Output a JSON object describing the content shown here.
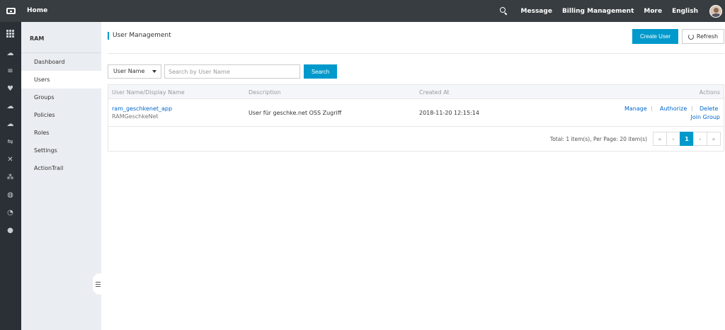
{
  "topbar": {
    "home": "Home",
    "links": [
      "Message",
      "Billing Management",
      "More",
      "English"
    ]
  },
  "rail": {
    "icons": [
      "apps-grid-icon",
      "cloud-icon",
      "database-icon",
      "trophy-icon",
      "cloud-upload-icon",
      "cloud-icon",
      "transfer-icon",
      "close-x-icon",
      "network-icon",
      "globe-icon",
      "pie-chart-icon",
      "circle-icon"
    ]
  },
  "sidebar": {
    "title": "RAM",
    "items": [
      {
        "label": "Dashboard"
      },
      {
        "label": "Users"
      },
      {
        "label": "Groups"
      },
      {
        "label": "Policies"
      },
      {
        "label": "Roles"
      },
      {
        "label": "Settings"
      },
      {
        "label": "ActionTrail"
      }
    ],
    "active_index": 1
  },
  "main": {
    "title": "User Management",
    "create_user": "Create User",
    "refresh": "Refresh"
  },
  "search": {
    "select_value": "User Name",
    "placeholder": "Search by User Name",
    "button": "Search"
  },
  "table": {
    "columns": {
      "name": "User Name/Display Name",
      "description": "Description",
      "created": "Created At",
      "actions": "Actions"
    },
    "rows": [
      {
        "user_name": "ram_geschkenet_app",
        "display_name": "RAMGeschkeNet",
        "description": "User für geschke.net OSS Zugriff",
        "created_at": "2018-11-20 12:15:14",
        "actions": {
          "manage": "Manage",
          "authorize": "Authorize",
          "delete": "Delete",
          "join_group": "Join Group"
        }
      }
    ],
    "footer": {
      "total": "Total: 1 item(s), Per Page: 20 item(s)",
      "pages": [
        "«",
        "‹",
        "1",
        "›",
        "»"
      ],
      "current_page": "1"
    }
  },
  "colors": {
    "accent": "#0099cc",
    "link": "#0066cc",
    "topbar": "#373d41",
    "rail": "#2b3036",
    "sidebar": "#eaedf1"
  }
}
